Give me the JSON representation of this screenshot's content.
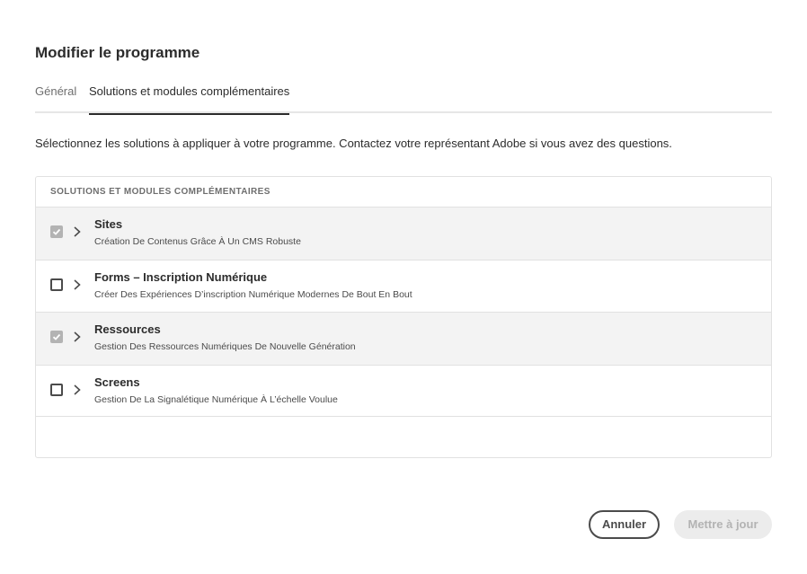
{
  "dialog": {
    "title": "Modifier le programme"
  },
  "tabs": {
    "general": "Général",
    "solutions": "Solutions et modules complémentaires"
  },
  "description": "Sélectionnez les solutions à appliquer à votre programme. Contactez votre représentant Adobe si vous avez des questions.",
  "table": {
    "header": "SOLUTIONS ET MODULES COMPLÉMENTAIRES",
    "rows": [
      {
        "title": "Sites",
        "subtitle": "Création De Contenus Grâce À Un CMS Robuste",
        "checked": true,
        "disabled": true
      },
      {
        "title": "Forms – Inscription Numérique",
        "subtitle": "Créer Des Expériences D’inscription Numérique Modernes De Bout En Bout",
        "checked": false,
        "disabled": false
      },
      {
        "title": "Ressources",
        "subtitle": "Gestion Des Ressources Numériques De Nouvelle Génération",
        "checked": true,
        "disabled": true
      },
      {
        "title": "Screens",
        "subtitle": "Gestion De La Signalétique Numérique À L’échelle Voulue",
        "checked": false,
        "disabled": false
      }
    ]
  },
  "buttons": {
    "cancel": "Annuler",
    "update": "Mettre à jour"
  },
  "colors": {
    "text": "#2c2c2c",
    "muted": "#6e6e6e",
    "disabled": "#b3b3b3",
    "selected_row": "#f3f3f3"
  }
}
